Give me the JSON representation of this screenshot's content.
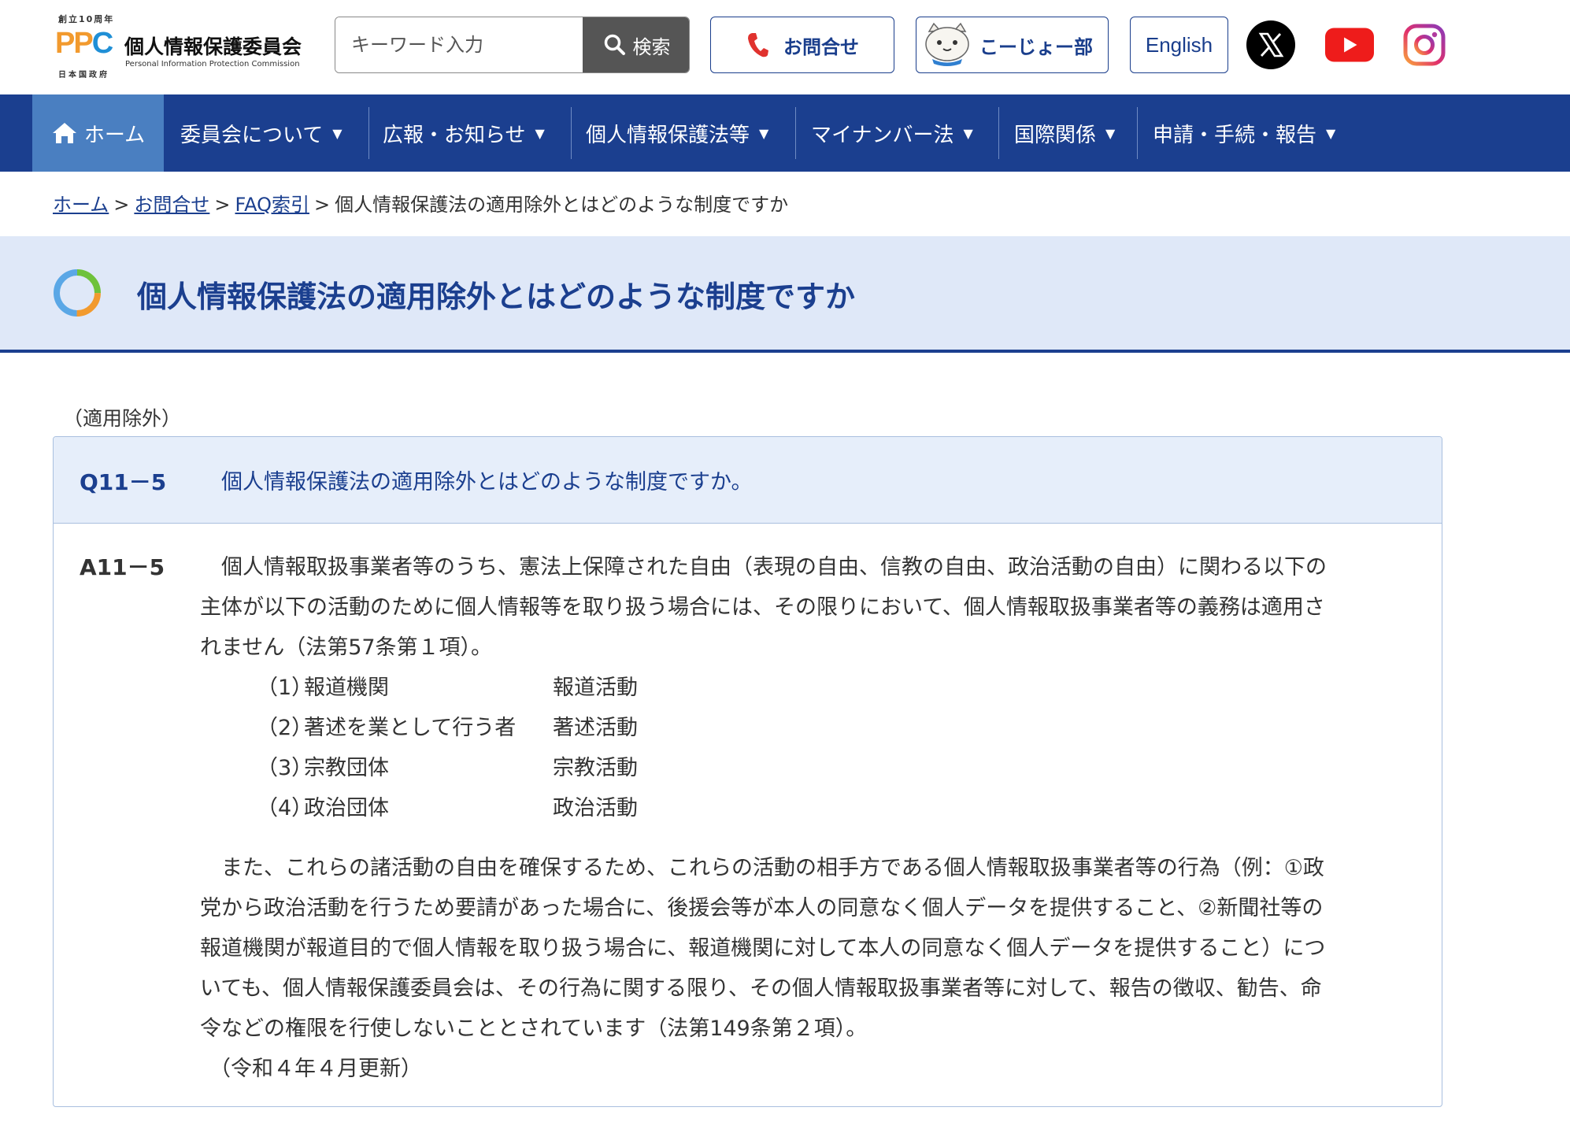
{
  "header": {
    "logo": {
      "top_text": "創立10周年",
      "ppc_text": "PPC",
      "org_name": "個人情報保護委員会",
      "org_name_en": "Personal Information Protection Commission",
      "bottom_text": "日本国政府"
    },
    "search": {
      "placeholder": "キーワード入力",
      "value": "",
      "button_label": "検索"
    },
    "contact_label": "お問合せ",
    "kojo_label": "こーじょー部",
    "english_label": "English",
    "social": [
      "x-icon",
      "youtube-icon",
      "instagram-icon"
    ]
  },
  "nav": {
    "items": [
      {
        "label": "ホーム"
      },
      {
        "label": "委員会について"
      },
      {
        "label": "広報・お知らせ"
      },
      {
        "label": "個人情報保護法等"
      },
      {
        "label": "マイナンバー法"
      },
      {
        "label": "国際関係"
      },
      {
        "label": "申請・手続・報告"
      }
    ],
    "caret": "▼"
  },
  "breadcrumb": {
    "items": [
      "ホーム",
      "お問合せ",
      "FAQ索引"
    ],
    "current": "個人情報保護法の適用除外とはどのような制度ですか",
    "separator": ">"
  },
  "page": {
    "title": "個人情報保護法の適用除外とはどのような制度ですか",
    "category": "（適用除外）"
  },
  "qa": {
    "q_num": "Q11－5",
    "q_text": "個人情報保護法の適用除外とはどのような制度ですか。",
    "a_num": "A11－5",
    "a_para1_lines": [
      "個人情報取扱事業者等のうち、憲法上保障された自由（表現の自由、信教の自由、政治活動の自由）に関わる以下の",
      "主体が以下の活動のために個人情報等を取り扱う場合には、その限りにおいて、個人情報取扱事業者等の義務は適用さ",
      "れません（法第57条第１項）。"
    ],
    "list": [
      {
        "idx": "（1）",
        "subject": "報道機関",
        "activity": "報道活動"
      },
      {
        "idx": "（2）",
        "subject": "著述を業として行う者",
        "activity": "著述活動"
      },
      {
        "idx": "（3）",
        "subject": "宗教団体",
        "activity": "宗教活動"
      },
      {
        "idx": "（4）",
        "subject": "政治団体",
        "activity": "政治活動"
      }
    ],
    "a_para2_lines": [
      "また、これらの諸活動の自由を確保するため、これらの活動の相手方である個人情報取扱事業者等の行為（例：①政",
      "党から政治活動を行うため要請があった場合に、後援会等が本人の同意なく個人データを提供すること、②新聞社等の",
      "報道機関が報道目的で個人情報を取り扱う場合に、報道機関に対して本人の同意なく個人データを提供すること）につ",
      "いても、個人情報保護委員会は、その行為に関する限り、その個人情報取扱事業者等に対して、報告の徴収、勧告、命",
      "令などの権限を行使しないこととされています（法第149条第２項）。"
    ],
    "updated": "（令和４年４月更新）"
  },
  "colors": {
    "navy": "#1b3f8f",
    "nav_home_active": "#4a7fc1",
    "title_band": "#dfe8f8",
    "question_bg": "#e6eefa",
    "logo_orange": "#f29a2e",
    "logo_blue": "#1f8fd6",
    "contact_red": "#e0322e"
  }
}
